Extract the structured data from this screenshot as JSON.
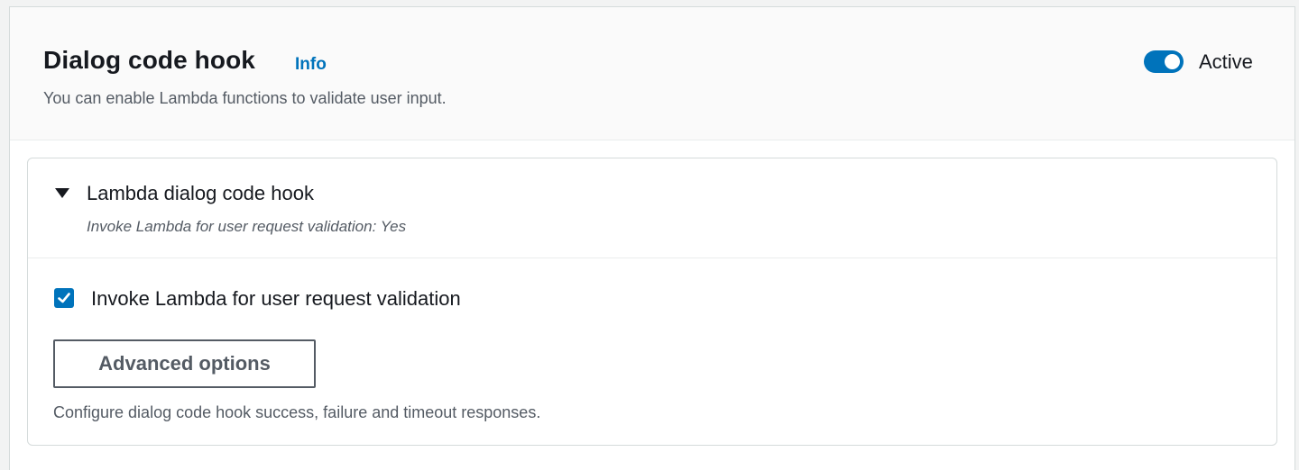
{
  "header": {
    "title": "Dialog code hook",
    "info_label": "Info",
    "description": "You can enable Lambda functions to validate user input.",
    "toggle": {
      "label": "Active",
      "checked": true
    }
  },
  "lambda_section": {
    "title": "Lambda dialog code hook",
    "summary": "Invoke Lambda for user request validation: Yes",
    "expanded": true,
    "checkbox": {
      "label": "Invoke Lambda for user request validation",
      "checked": true
    },
    "advanced_button_label": "Advanced options",
    "helper_text": "Configure dialog code hook success, failure and timeout responses."
  },
  "colors": {
    "accent": "#0073bb",
    "text": "#16191f",
    "secondary_text": "#545b64",
    "border": "#d5dbdb"
  }
}
